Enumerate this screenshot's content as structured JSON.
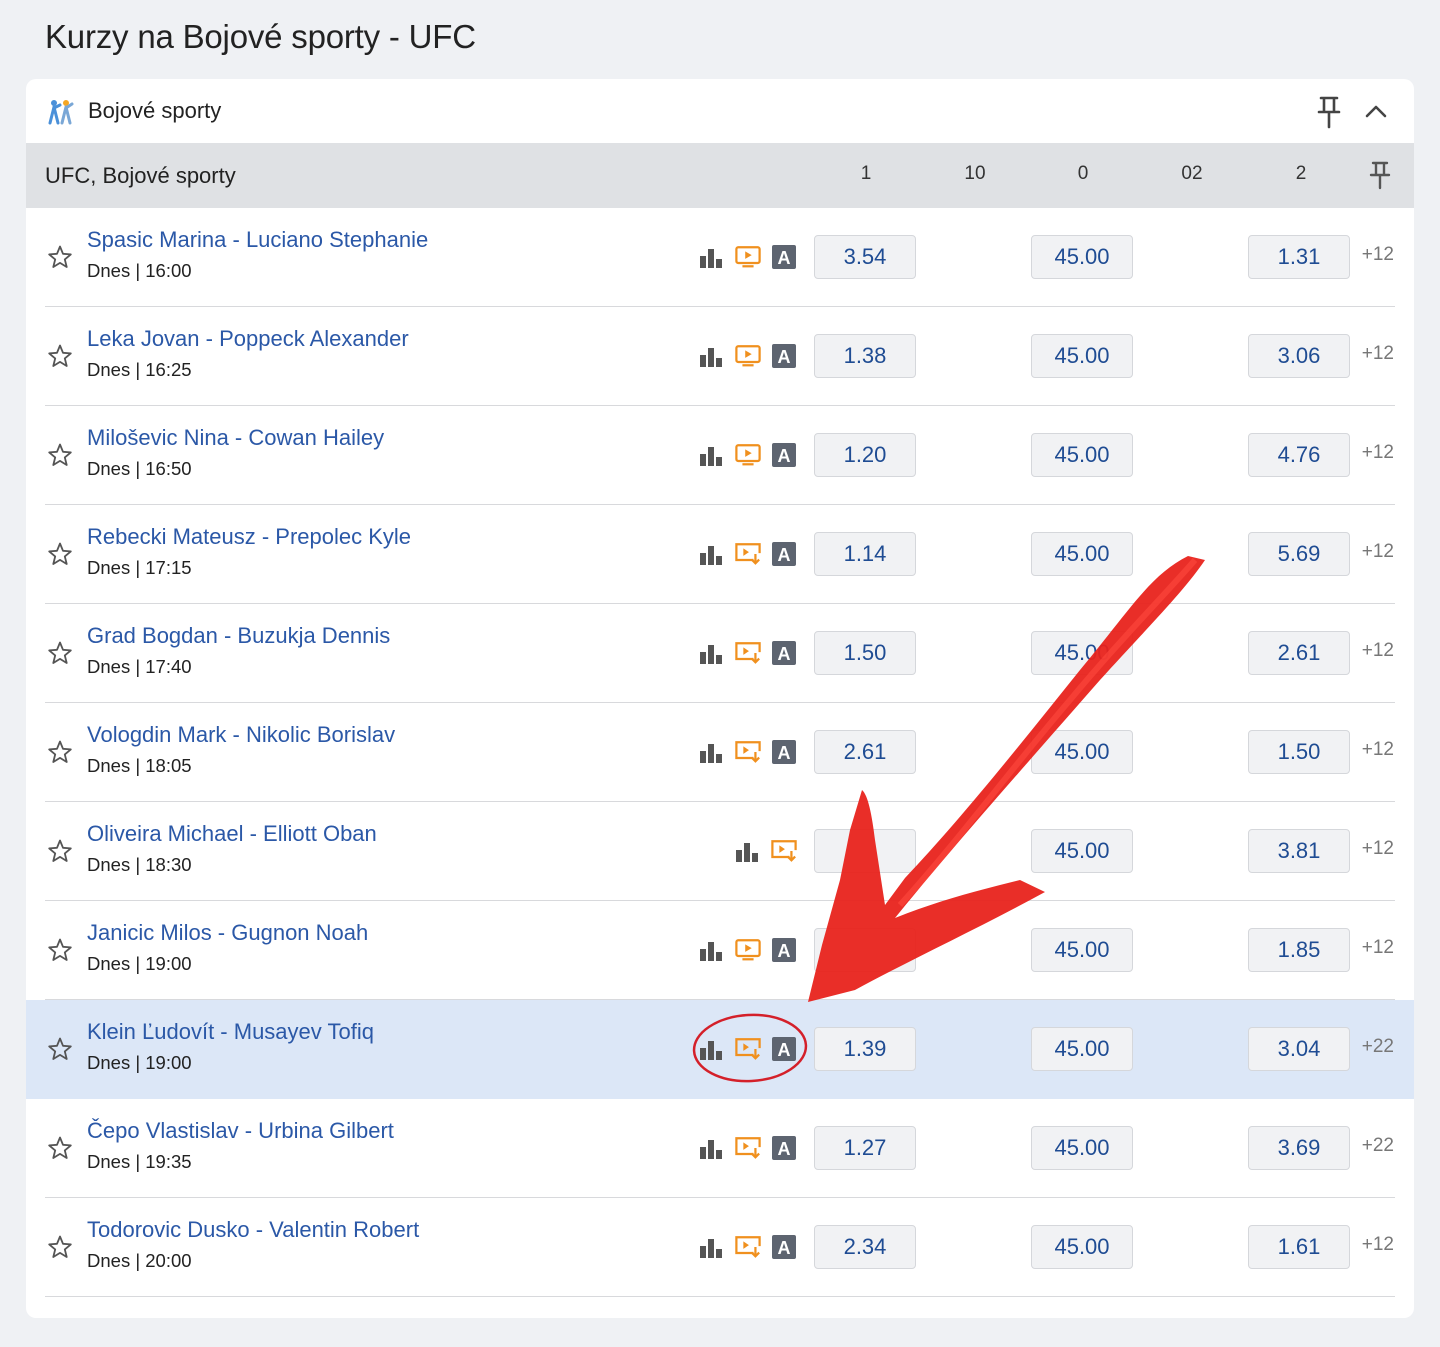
{
  "page": {
    "title": "Kurzy na Bojové sporty - UFC"
  },
  "sport": {
    "label": "Bojové sporty",
    "icon": "martial-arts-icon"
  },
  "league": {
    "name": "UFC, Bojové sporty",
    "columns": [
      "1",
      "10",
      "0",
      "02",
      "2"
    ]
  },
  "matches": [
    {
      "name": "Spasic Marina - Luciano Stephanie",
      "time": "Dnes | 16:00",
      "odd1": "3.54",
      "oddX": "45.00",
      "odd2": "1.31",
      "more": "+12",
      "media": "play",
      "a_badge": true,
      "highlight": false
    },
    {
      "name": "Leka Jovan - Poppeck Alexander",
      "time": "Dnes | 16:25",
      "odd1": "1.38",
      "oddX": "45.00",
      "odd2": "3.06",
      "more": "+12",
      "media": "play",
      "a_badge": true,
      "highlight": false
    },
    {
      "name": "Miloševic Nina - Cowan Hailey",
      "time": "Dnes | 16:50",
      "odd1": "1.20",
      "oddX": "45.00",
      "odd2": "4.76",
      "more": "+12",
      "media": "play",
      "a_badge": true,
      "highlight": false
    },
    {
      "name": "Rebecki Mateusz - Prepolec Kyle",
      "time": "Dnes | 17:15",
      "odd1": "1.14",
      "oddX": "45.00",
      "odd2": "5.69",
      "more": "+12",
      "media": "stream",
      "a_badge": true,
      "highlight": false
    },
    {
      "name": "Grad Bogdan - Buzukja Dennis",
      "time": "Dnes | 17:40",
      "odd1": "1.50",
      "oddX": "45.00",
      "odd2": "2.61",
      "more": "+12",
      "media": "stream",
      "a_badge": true,
      "highlight": false
    },
    {
      "name": "Vologdin Mark - Nikolic Borislav",
      "time": "Dnes | 18:05",
      "odd1": "2.61",
      "oddX": "45.00",
      "odd2": "1.50",
      "more": "+12",
      "media": "stream",
      "a_badge": true,
      "highlight": false
    },
    {
      "name": "Oliveira Michael - Elliott Oban",
      "time": "Dnes | 18:30",
      "odd1": "",
      "oddX": "45.00",
      "odd2": "3.81",
      "more": "+12",
      "media": "stream",
      "a_badge": false,
      "highlight": false
    },
    {
      "name": "Janicic Milos - Gugnon Noah",
      "time": "Dnes | 19:00",
      "odd1": "",
      "oddX": "45.00",
      "odd2": "1.85",
      "more": "+12",
      "media": "play",
      "a_badge": true,
      "highlight": false
    },
    {
      "name": "Klein Ľudovít - Musayev Tofiq",
      "time": "Dnes | 19:00",
      "odd1": "1.39",
      "oddX": "45.00",
      "odd2": "3.04",
      "more": "+22",
      "media": "stream",
      "a_badge": true,
      "highlight": true
    },
    {
      "name": "Čepo Vlastislav - Urbina Gilbert",
      "time": "Dnes | 19:35",
      "odd1": "1.27",
      "oddX": "45.00",
      "odd2": "3.69",
      "more": "+22",
      "media": "stream",
      "a_badge": true,
      "highlight": false
    },
    {
      "name": "Todorovic Dusko - Valentin Robert",
      "time": "Dnes | 20:00",
      "odd1": "2.34",
      "oddX": "45.00",
      "odd2": "1.61",
      "more": "+12",
      "media": "stream",
      "a_badge": true,
      "highlight": false
    }
  ],
  "annotation": {
    "arrow_color": "#e8231c",
    "circle_color": "#d4202a"
  }
}
